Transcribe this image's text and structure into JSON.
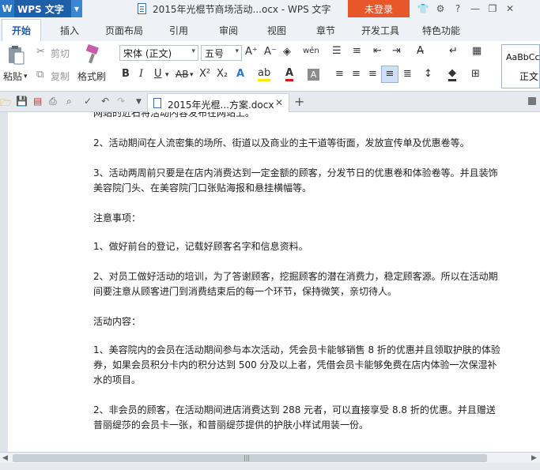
{
  "titlebar": {
    "app_name": "WPS 文字",
    "window_title": "2015年光棍节商场活动...ocx - WPS 文字",
    "login_label": "未登录"
  },
  "menu": {
    "tabs": [
      "开始",
      "插入",
      "页面布局",
      "引用",
      "审阅",
      "视图",
      "章节",
      "开发工具",
      "特色功能"
    ]
  },
  "ribbon": {
    "paste_label": "粘贴",
    "cut_label": "剪切",
    "copy_label": "复制",
    "format_painter_label": "格式刷",
    "font_name": "宋体 (正文)",
    "font_size": "五号",
    "style_preview": "AaBbCc",
    "style_name": "正文"
  },
  "tabbar": {
    "document_tab": "2015年光棍...方案.docx"
  },
  "document": {
    "cut_line": "网站的近石将活动内容发布在网站上。",
    "paragraphs": [
      "2、活动期间在人流密集的场所、街道以及商业的主干道等街面，发放宣传单及优惠卷等。",
      "3、活动两周前只要是在店内消费达到一定金额的顾客，分发节日的优惠卷和体验卷等。并且装饰美容院门头、在美容院门口张贴海报和悬挂横幅等。",
      "注意事项：",
      "1、做好前台的登记，记载好顾客名字和信息资料。",
      "2、对员工做好活动的培训，为了答谢顾客，挖掘顾客的潜在消费力，稳定顾客源。所以在活动期间要注意从顾客进门到消费结束后的每一个环节，保持微笑，亲切待人。",
      "活动内容：",
      "1、美容院内的会员在活动期间参与本次活动，凭会员卡能够销售 8 折的优惠并且领取护肤的体验券，如果会员积分卡内的积分达到 500 分及以上者，凭借会员卡能够免费在店内体验一次保湿补水的项目。",
      "2、非会员的顾客，在活动期间进店消费达到 288 元者，可以直接享受 8.8 折的优惠。并且赠送普丽缇莎的会员卡一张，和普丽缇莎提供的护肤小样试用装一份。"
    ]
  }
}
